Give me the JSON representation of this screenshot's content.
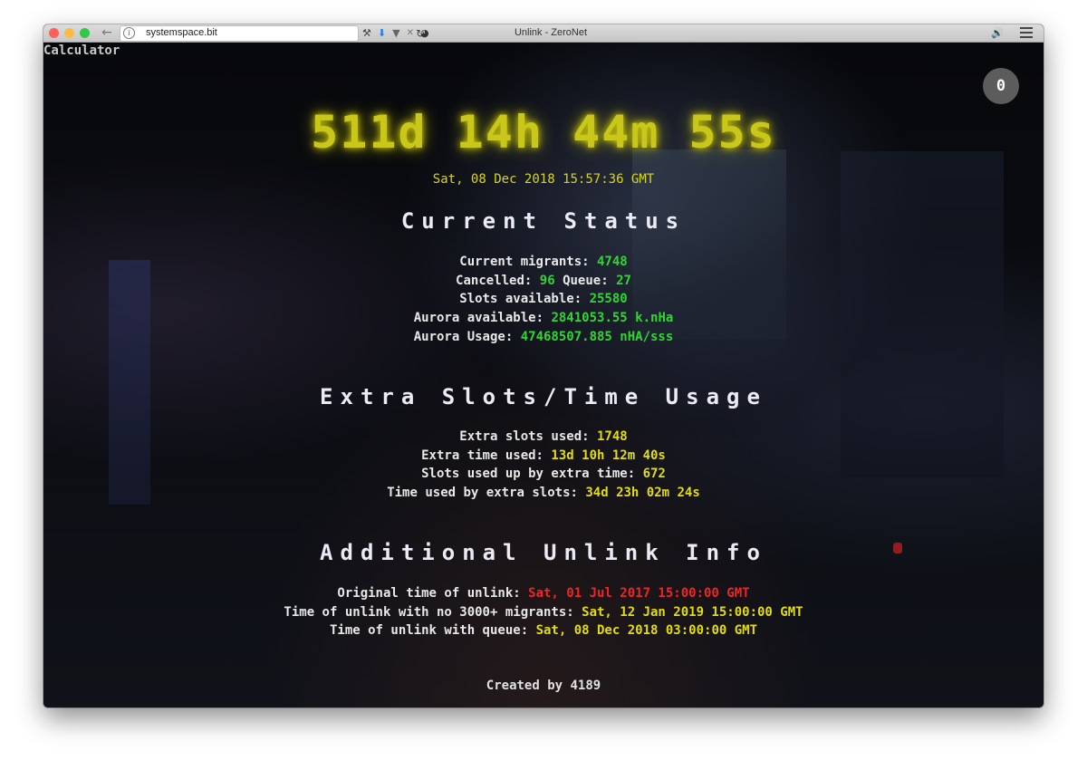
{
  "browser": {
    "url": "systemspace.bit",
    "tab_title": "Unlink - ZeroNet"
  },
  "page": {
    "calculator_label": "Calculator",
    "counter_badge": "0",
    "countdown": "511d 14h 44m 55s",
    "current_date": "Sat, 08 Dec 2018 15:57:36 GMT"
  },
  "current_status": {
    "title": "Current Status",
    "migrants_label": "Current migrants:",
    "migrants_value": "4748",
    "cancelled_label": "Cancelled:",
    "cancelled_value": "96",
    "queue_label": "Queue:",
    "queue_value": "27",
    "slots_label": "Slots available:",
    "slots_value": "25580",
    "aurora_available_label": "Aurora available:",
    "aurora_available_value": "2841053.55 k.nHa",
    "aurora_usage_label": "Aurora Usage:",
    "aurora_usage_value": "47468507.885 nHA/sss"
  },
  "extra_usage": {
    "title": "Extra Slots/Time Usage",
    "slots_used_label": "Extra slots used:",
    "slots_used_value": "1748",
    "time_used_label": "Extra time used:",
    "time_used_value": "13d 10h 12m 40s",
    "slots_by_time_label": "Slots used up by extra time:",
    "slots_by_time_value": "672",
    "time_by_slots_label": "Time used by extra slots:",
    "time_by_slots_value": "34d 23h 02m 24s"
  },
  "unlink_info": {
    "title": "Additional Unlink Info",
    "original_label": "Original time of unlink:",
    "original_value": "Sat, 01 Jul 2017 15:00:00 GMT",
    "no_3000_label": "Time of unlink with no 3000+ migrants:",
    "no_3000_value": "Sat, 12 Jan 2019 15:00:00 GMT",
    "queue_label": "Time of unlink with queue:",
    "queue_value": "Sat, 08 Dec 2018 03:00:00 GMT"
  },
  "footer": {
    "credit": "Created by 4189"
  },
  "colors": {
    "countdown": "#c9c71a",
    "status_value": "#2fd633",
    "extra_value": "#e2dc10",
    "original_unlink": "#f22424"
  },
  "icons": [
    "back-arrow-icon",
    "info-icon",
    "reload-icon",
    "tool-icon",
    "download-icon",
    "pocket-icon",
    "close-icon",
    "update-icon",
    "speaker-icon",
    "menu-icon"
  ]
}
